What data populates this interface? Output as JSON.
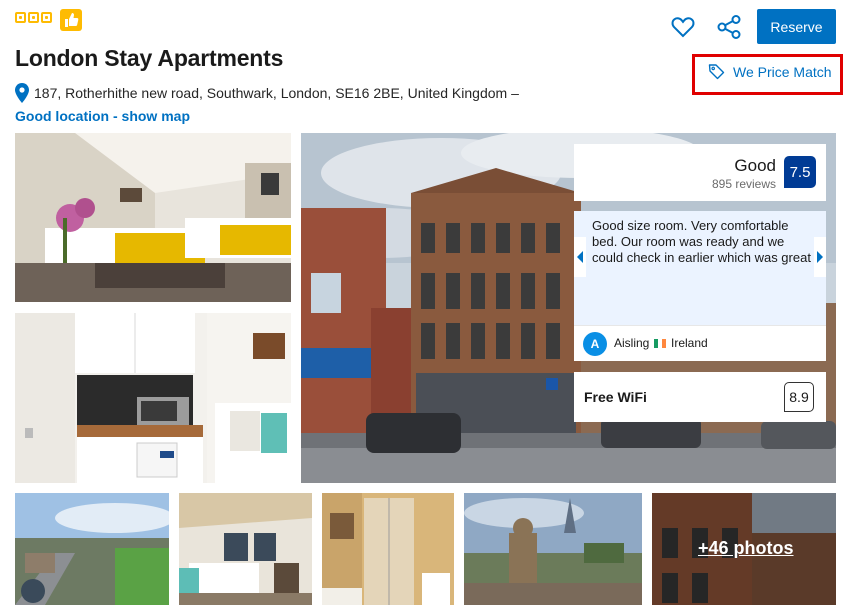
{
  "property": {
    "name": "London Stay Apartments",
    "address": "187, Rotherhithe new road, Southwark, London, SE16 2BE, United Kingdom –",
    "location_link": "Good location - show map",
    "star_rating": 3
  },
  "actions": {
    "reserve_label": "Reserve",
    "price_match_label": "We Price Match"
  },
  "rating": {
    "word": "Good",
    "reviews": "895 reviews",
    "score": "7.5"
  },
  "featured_review": {
    "text": "Good size room. Very comfortable bed. Our room was ready and we could check in earlier which was great",
    "author_initial": "A",
    "author": "Aisling",
    "country": "Ireland"
  },
  "facility": {
    "label": "Free WiFi",
    "score": "8.9"
  },
  "gallery": {
    "more_label": "+46 photos"
  },
  "colors": {
    "brand_blue": "#0071c2",
    "score_navy": "#003b95",
    "star_yellow": "#febb02",
    "highlight_red": "#e00000"
  },
  "icons": [
    "star-square-icon",
    "thumbs-up-icon",
    "heart-icon",
    "share-icon",
    "tag-icon",
    "map-pin-icon",
    "chevron-left-icon",
    "chevron-right-icon"
  ]
}
